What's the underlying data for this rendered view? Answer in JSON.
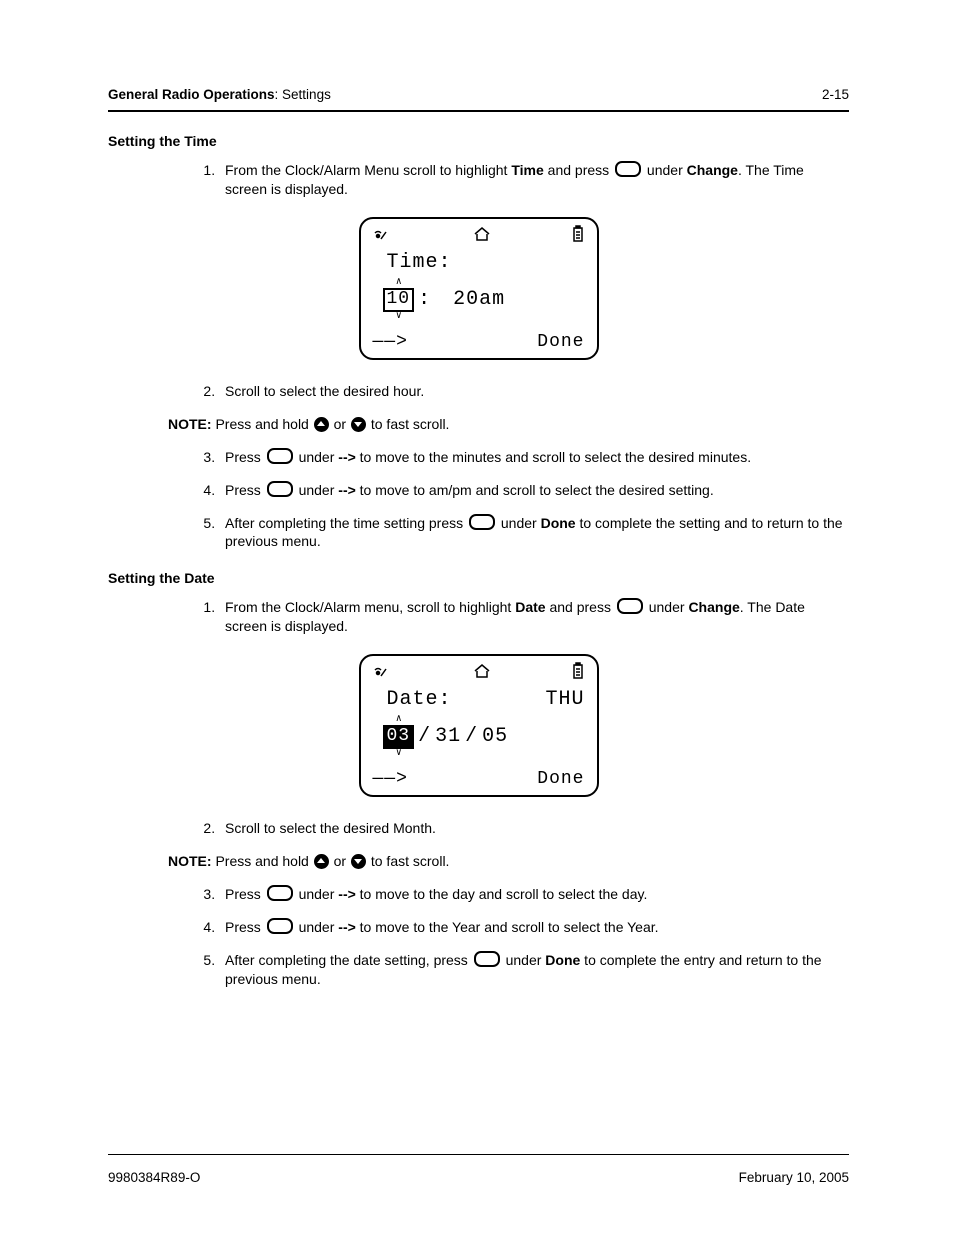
{
  "header": {
    "section_bold": "General Radio Operations",
    "section_rest": ": Settings",
    "page_num": "2-15"
  },
  "time": {
    "title": "Setting the Time",
    "steps": {
      "s1a": "From the Clock/Alarm Menu scroll to highlight ",
      "s1b": "Time",
      "s1c": " and press ",
      "s1d": " under ",
      "s1e": "Change",
      "s1f": ". The Time screen is displayed.",
      "s2": "Scroll to select the desired hour.",
      "s3a": "Press ",
      "s3b": " under ",
      "s3c": "-->",
      "s3d": " to move to the minutes and scroll to select the desired minutes.",
      "s4a": "Press ",
      "s4b": " under ",
      "s4c": "-->",
      "s4d": " to move to am/pm and scroll to select the desired setting.",
      "s5a": "After completing the time setting press ",
      "s5b": " under ",
      "s5c": "Done",
      "s5d": " to complete the setting and to return to the previous menu."
    },
    "note": {
      "label": "NOTE:",
      "a": " Press and hold ",
      "b": " or ",
      "c": " to fast scroll."
    },
    "lcd": {
      "label": "Time:",
      "hour": "10",
      "colon": ":",
      "rest": "20am",
      "left": "——>",
      "right": "Done"
    }
  },
  "date": {
    "title": "Setting the Date",
    "steps": {
      "s1a": "From the Clock/Alarm menu, scroll to highlight ",
      "s1b": "Date",
      "s1c": " and press ",
      "s1d": " under ",
      "s1e": "Change",
      "s1f": ". The Date screen is displayed.",
      "s2": "Scroll to select the desired Month.",
      "s3a": "Press ",
      "s3b": " under ",
      "s3c": "-->",
      "s3d": " to move to the day and scroll to select the day.",
      "s4a": "Press ",
      "s4b": " under ",
      "s4c": "-->",
      "s4d": " to move to the Year and scroll to select the Year.",
      "s5a": "After completing the date setting, press ",
      "s5b": " under ",
      "s5c": "Done",
      "s5d": " to complete the entry and return to the previous menu."
    },
    "note": {
      "label": "NOTE:",
      "a": " Press and hold ",
      "b": " or ",
      "c": " to fast scroll."
    },
    "lcd": {
      "label": "Date:",
      "dow": "THU",
      "month": "03",
      "sep1": " / ",
      "day": "31",
      "sep2": " / ",
      "year": "05",
      "left": "——>",
      "right": "Done"
    }
  },
  "footer": {
    "doc": "9980384R89-O",
    "date": "February 10, 2005"
  }
}
